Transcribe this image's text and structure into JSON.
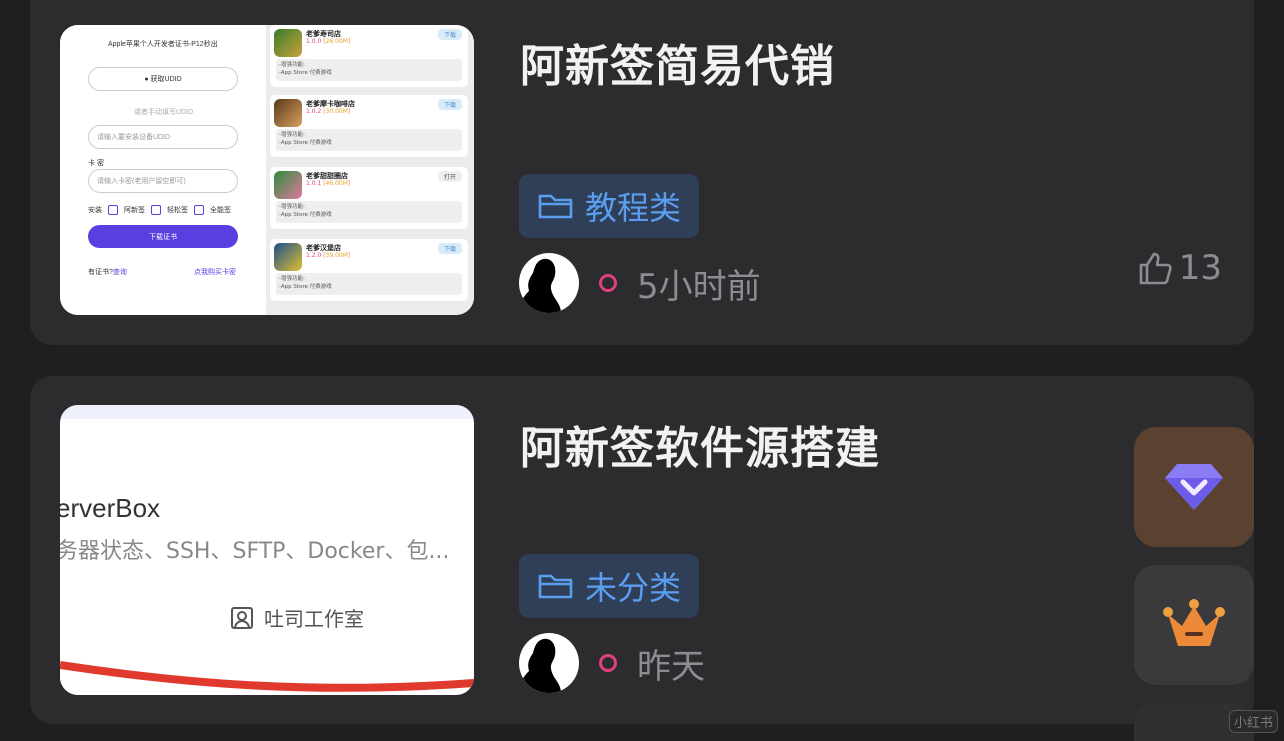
{
  "posts": [
    {
      "title": "阿新签简易代销",
      "category": "教程类",
      "time": "5小时前",
      "likes": "13",
      "thumbnail": {
        "header": "Apple苹果个人开发者证书-P12秒出",
        "udid_button": "获取UDID",
        "manual_hint": "或者手动填写UDID",
        "udid_placeholder": "请输入要安装设备UDID",
        "card_label": "卡 密",
        "card_placeholder": "请输入卡密(老用户留空即可)",
        "install_label": "安装",
        "options": [
          "阿新签",
          "轻松签",
          "全能签"
        ],
        "download_button": "下载证书",
        "have_cert": "有证书?",
        "query_link": "查询",
        "buy_link": "点我购买卡密",
        "apps": [
          {
            "name": "老爹寿司店",
            "version": "1.0.0",
            "size": "[26.00M]",
            "action": "下载",
            "desc1": "-增强功能:",
            "desc2": "-App Store 付费游戏"
          },
          {
            "name": "老爹摩卡咖啡店",
            "version": "1.0.2",
            "size": "[30.00M]",
            "action": "下载",
            "desc1": "-增强功能:",
            "desc2": "-App Store 付费游戏"
          },
          {
            "name": "老爹甜甜圈店",
            "version": "1.0.1",
            "size": "[46.00M]",
            "action": "打开",
            "desc1": "-增强功能:",
            "desc2": "-App Store 付费游戏"
          },
          {
            "name": "老爹汉堡店",
            "version": "1.2.0",
            "size": "[39.00M]",
            "action": "下载",
            "desc1": "-增强功能:",
            "desc2": "-App Store 付费游戏"
          }
        ]
      }
    },
    {
      "title": "阿新签软件源搭建",
      "category": "未分类",
      "time": "昨天",
      "thumbnail": {
        "app_name": "erverBox",
        "app_desc": "务器状态、SSH、SFTP、Docker、包...",
        "studio": "吐司工作室"
      }
    }
  ],
  "watermark": "小红书",
  "colors": {
    "accent_blue": "#5b9ef0",
    "tag_bg": "#2e3f57",
    "dot_pink": "#e0407c",
    "vip_bg": "#5b4130"
  }
}
